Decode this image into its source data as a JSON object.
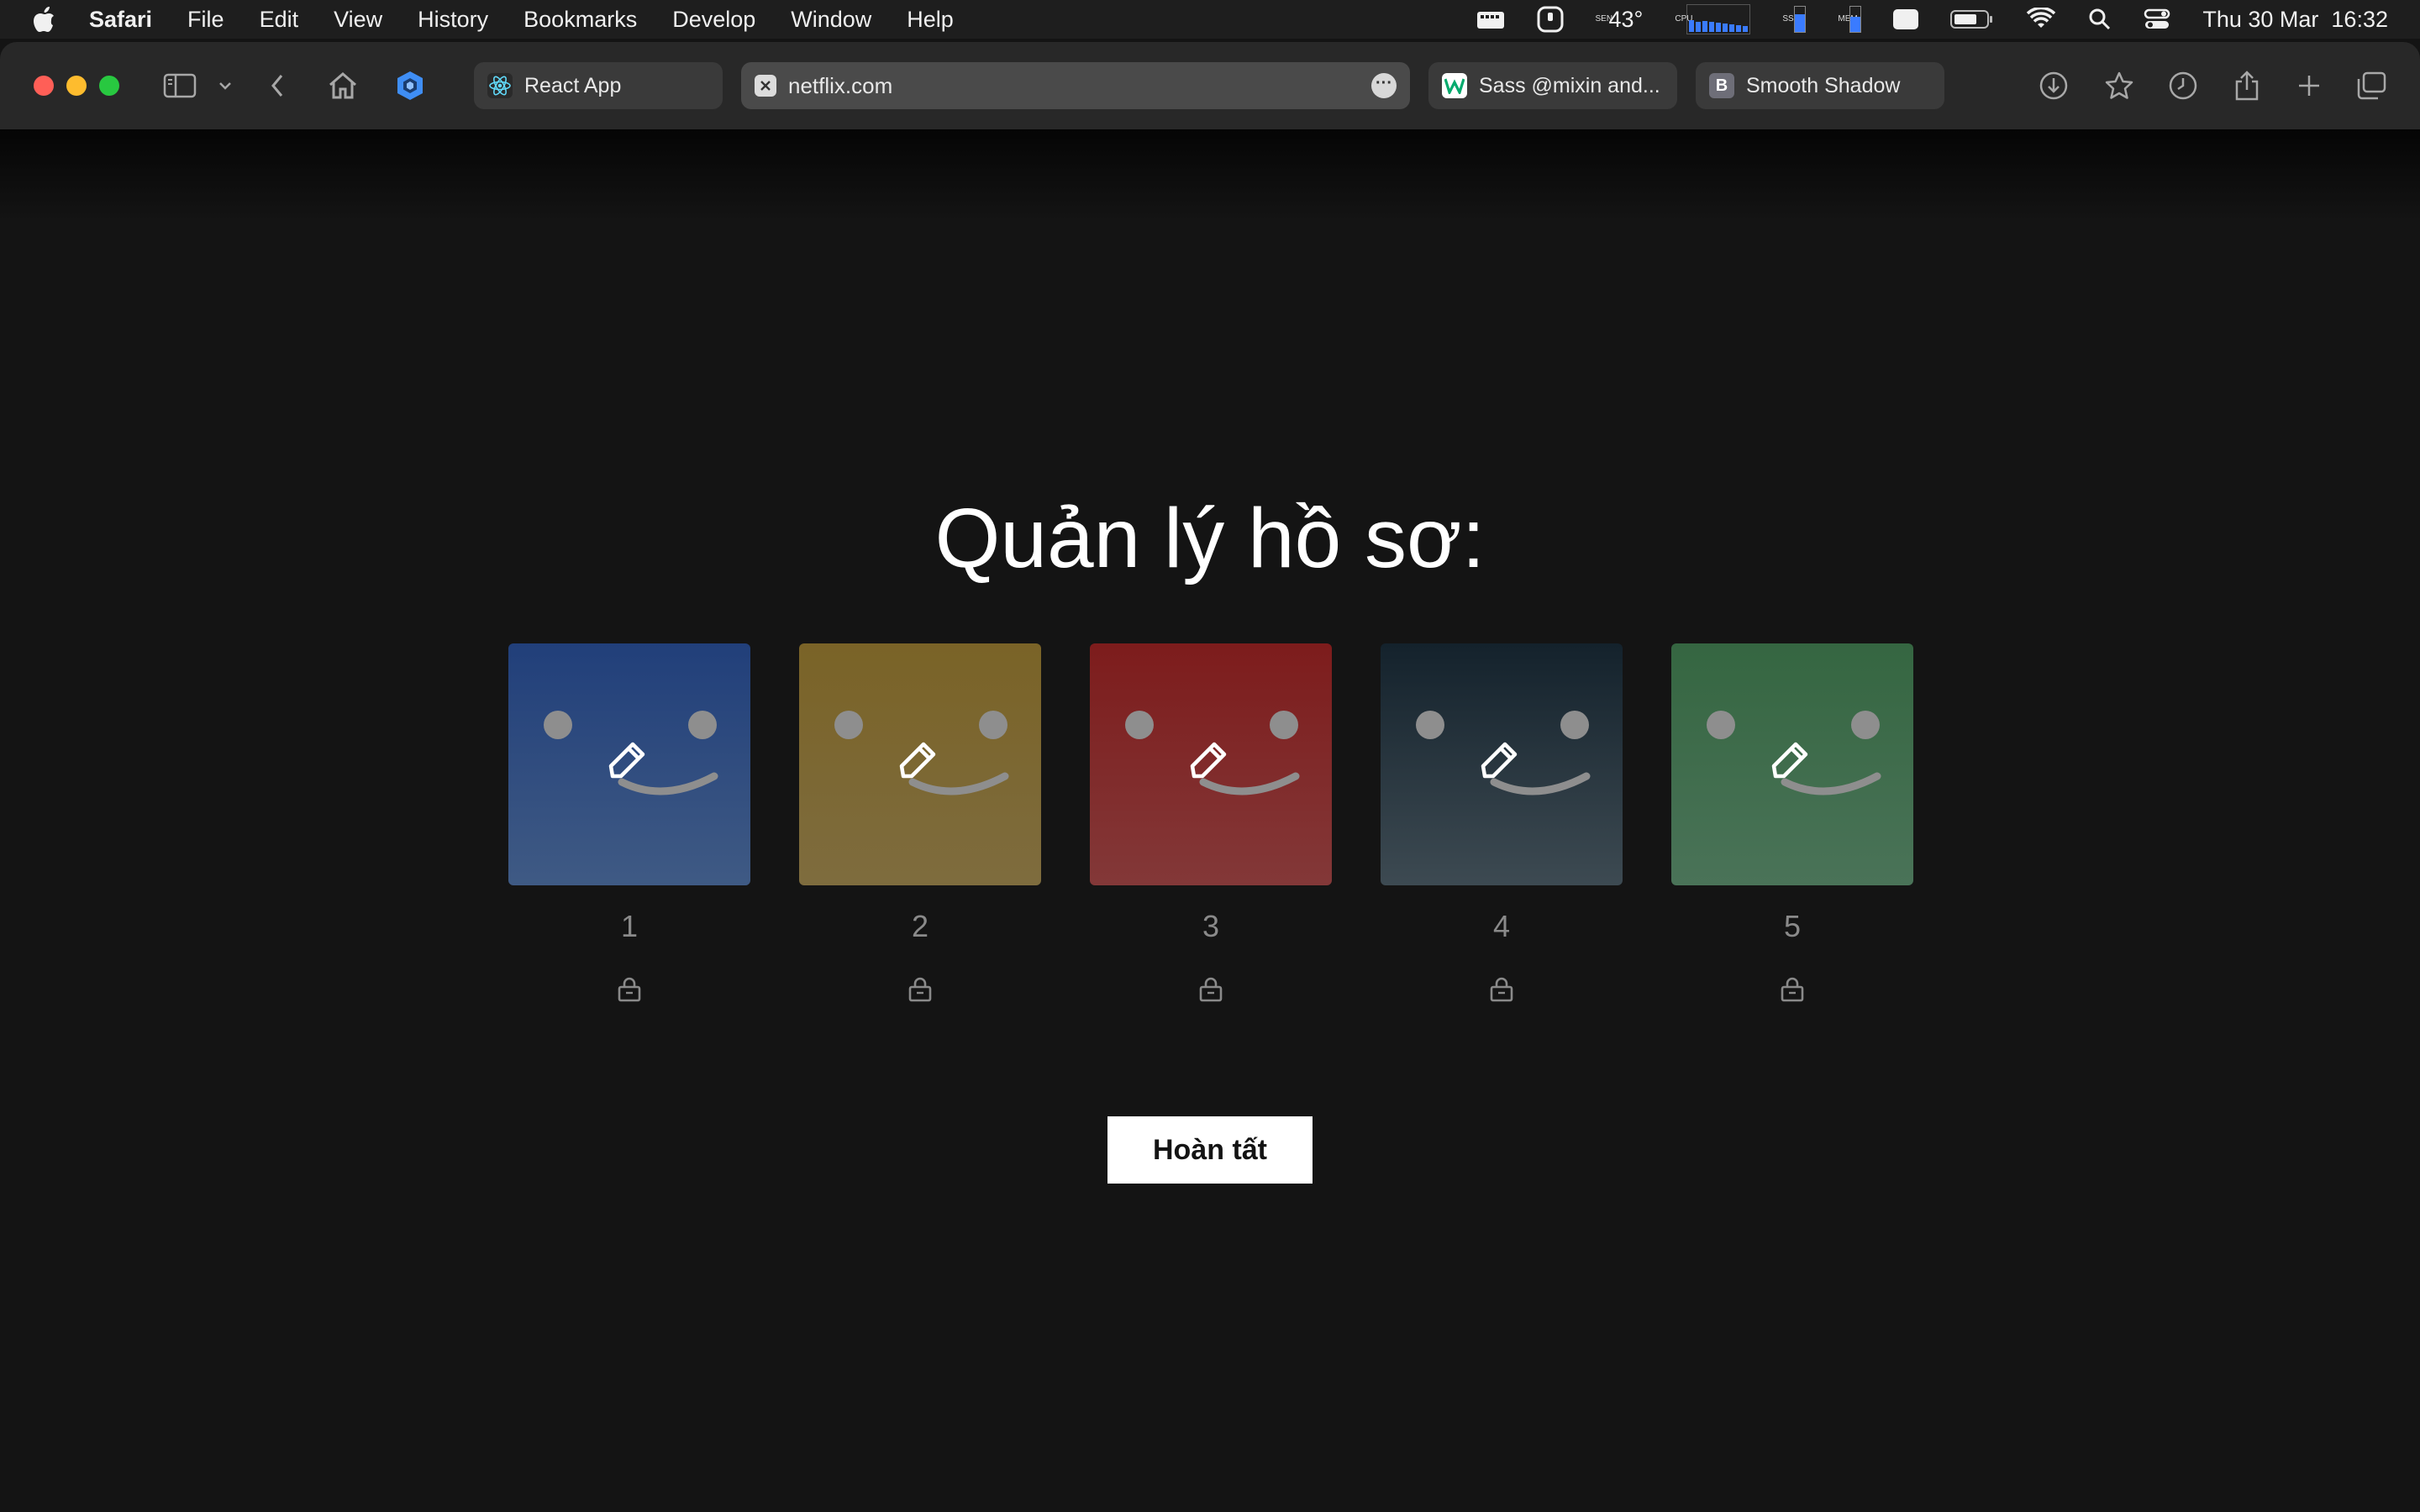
{
  "menubar": {
    "app_name": "Safari",
    "items": [
      "File",
      "Edit",
      "View",
      "History",
      "Bookmarks",
      "Develop",
      "Window",
      "Help"
    ],
    "status": {
      "temperature": "43°",
      "temp_label": "SEN",
      "cpu_label": "CPU",
      "ssd_label": "SSD",
      "mem_label": "MEM",
      "input_source": "A",
      "datetime": "Thu 30 Mar  16:32"
    }
  },
  "browser": {
    "tabs": [
      {
        "title": "React App",
        "favicon": "react-icon"
      },
      {
        "title": "netflix.com",
        "favicon": "close-tab-icon",
        "active": true
      },
      {
        "title": "Sass @mixin and...",
        "favicon": "w3-icon"
      },
      {
        "title": "Smooth Shadow",
        "favicon": "B"
      }
    ]
  },
  "page": {
    "title": "Quản lý hồ sơ:",
    "profiles": [
      {
        "name": "1",
        "color_top": "#213f7a",
        "color_bottom": "#3f5a84"
      },
      {
        "name": "2",
        "color_top": "#7a6327",
        "color_bottom": "#7e6c3e"
      },
      {
        "name": "3",
        "color_top": "#7d1c1c",
        "color_bottom": "#833838"
      },
      {
        "name": "4",
        "color_top": "#14222c",
        "color_bottom": "#3d4a52"
      },
      {
        "name": "5",
        "color_top": "#356641",
        "color_bottom": "#4a7358"
      }
    ],
    "done_button": "Hoàn tất"
  },
  "colors": {
    "background": "#141414",
    "button_bg": "#ffffff",
    "profile_name": "#8a8a8a"
  }
}
